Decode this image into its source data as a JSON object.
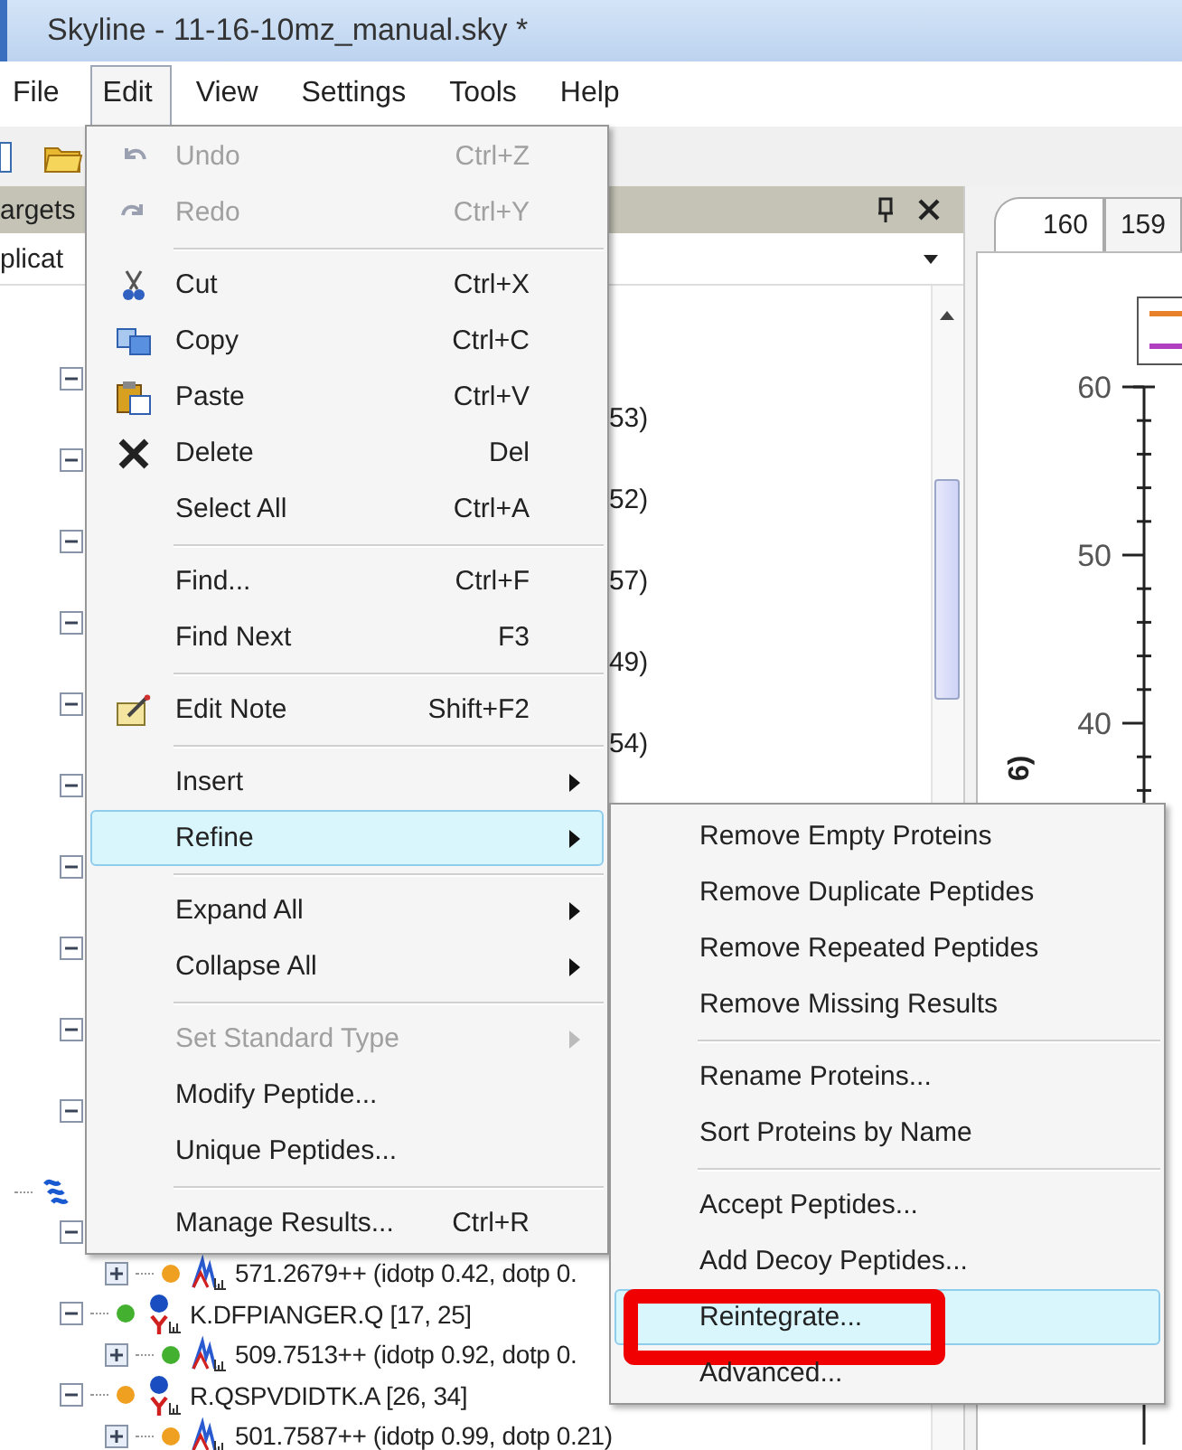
{
  "window": {
    "title": "Skyline - 11-16-10mz_manual.sky *"
  },
  "menubar": [
    {
      "label": "File",
      "selected": false
    },
    {
      "label": "Edit",
      "selected": true
    },
    {
      "label": "View",
      "selected": false
    },
    {
      "label": "Settings",
      "selected": false
    },
    {
      "label": "Tools",
      "selected": false
    },
    {
      "label": "Help",
      "selected": false
    }
  ],
  "targets_panel": {
    "title": "argets",
    "replicate": "plicat",
    "rows": [
      {
        "kind": "peptide",
        "expanded": true
      },
      {
        "kind": "precursor",
        "tail": "53)"
      },
      {
        "kind": "peptide",
        "expanded": true
      },
      {
        "kind": "precursor",
        "tail": "52)"
      },
      {
        "kind": "peptide",
        "expanded": true
      },
      {
        "kind": "precursor",
        "tail": "57)"
      },
      {
        "kind": "peptide",
        "expanded": true
      },
      {
        "kind": "precursor",
        "tail": "49)"
      },
      {
        "kind": "peptide",
        "expanded": true
      },
      {
        "kind": "precursor",
        "tail": "54)"
      },
      {
        "kind": "peptide",
        "expanded": true
      },
      {
        "kind": "precursor"
      },
      {
        "kind": "peptide",
        "expanded": true
      },
      {
        "kind": "precursor"
      },
      {
        "kind": "peptide",
        "expanded": true
      },
      {
        "kind": "precursor"
      },
      {
        "kind": "peptide",
        "expanded": true
      },
      {
        "kind": "precursor"
      },
      {
        "kind": "peptide",
        "expanded": true
      },
      {
        "kind": "precursor"
      },
      {
        "kind": "protein"
      },
      {
        "kind": "peptide",
        "expanded": true
      },
      {
        "kind": "precursor",
        "expanded": false,
        "color": "#f0a020",
        "text": "571.2679++ (idotp 0.42, dotp 0."
      },
      {
        "kind": "peptide",
        "expanded": true,
        "color": "#44b030",
        "text": "K.DFPIANGER.Q [17, 25]"
      },
      {
        "kind": "precursor",
        "expanded": false,
        "color": "#44b030",
        "text": "509.7513++ (idotp 0.92, dotp 0."
      },
      {
        "kind": "peptide",
        "expanded": true,
        "color": "#f0a020",
        "text": "R.QSPVDIDTK.A [26, 34]"
      },
      {
        "kind": "precursor",
        "expanded": false,
        "color": "#f0a020",
        "text": "501.7587++ (idotp 0.99, dotp 0.21)"
      }
    ]
  },
  "graph_panel": {
    "tabs": [
      {
        "label": "160",
        "selected": true
      },
      {
        "label": "159",
        "selected": false
      }
    ],
    "legend": [
      {
        "color": "#e8822a"
      },
      {
        "color": "#b040c0"
      }
    ],
    "y_ticks": [
      "60",
      "50",
      "40"
    ],
    "axis_label": "6)"
  },
  "edit_menu": [
    {
      "kind": "item",
      "label": "Undo",
      "shortcut": "Ctrl+Z",
      "disabled": true,
      "selected": false,
      "submenu": false
    },
    {
      "kind": "item",
      "label": "Redo",
      "shortcut": "Ctrl+Y",
      "disabled": true,
      "selected": false,
      "submenu": false
    },
    {
      "kind": "separator"
    },
    {
      "kind": "item",
      "label": "Cut",
      "shortcut": "Ctrl+X",
      "disabled": false,
      "selected": false,
      "submenu": false
    },
    {
      "kind": "item",
      "label": "Copy",
      "shortcut": "Ctrl+C",
      "disabled": false,
      "selected": false,
      "submenu": false
    },
    {
      "kind": "item",
      "label": "Paste",
      "shortcut": "Ctrl+V",
      "disabled": false,
      "selected": false,
      "submenu": false
    },
    {
      "kind": "item",
      "label": "Delete",
      "shortcut": "Del",
      "disabled": false,
      "selected": false,
      "submenu": false
    },
    {
      "kind": "item",
      "label": "Select All",
      "shortcut": "Ctrl+A",
      "disabled": false,
      "selected": false,
      "submenu": false
    },
    {
      "kind": "separator"
    },
    {
      "kind": "item",
      "label": "Find...",
      "shortcut": "Ctrl+F",
      "disabled": false,
      "selected": false,
      "submenu": false
    },
    {
      "kind": "item",
      "label": "Find Next",
      "shortcut": "F3",
      "disabled": false,
      "selected": false,
      "submenu": false
    },
    {
      "kind": "separator"
    },
    {
      "kind": "item",
      "label": "Edit Note",
      "shortcut": "Shift+F2",
      "disabled": false,
      "selected": false,
      "submenu": false
    },
    {
      "kind": "separator"
    },
    {
      "kind": "item",
      "label": "Insert",
      "disabled": false,
      "selected": false,
      "submenu": true
    },
    {
      "kind": "item",
      "label": "Refine",
      "disabled": false,
      "selected": true,
      "submenu": true
    },
    {
      "kind": "separator"
    },
    {
      "kind": "item",
      "label": "Expand All",
      "disabled": false,
      "selected": false,
      "submenu": true
    },
    {
      "kind": "item",
      "label": "Collapse All",
      "disabled": false,
      "selected": false,
      "submenu": true
    },
    {
      "kind": "separator"
    },
    {
      "kind": "item",
      "label": "Set Standard Type",
      "disabled": true,
      "selected": false,
      "submenu": true
    },
    {
      "kind": "item",
      "label": "Modify Peptide...",
      "disabled": false,
      "selected": false,
      "submenu": false
    },
    {
      "kind": "item",
      "label": "Unique Peptides...",
      "disabled": false,
      "selected": false,
      "submenu": false
    },
    {
      "kind": "separator"
    },
    {
      "kind": "item",
      "label": "Manage Results...",
      "shortcut": "Ctrl+R",
      "disabled": false,
      "selected": false,
      "submenu": false
    }
  ],
  "refine_menu": [
    {
      "kind": "item",
      "label": "Remove Empty Proteins",
      "selected": false,
      "annotated": false
    },
    {
      "kind": "item",
      "label": "Remove Duplicate Peptides",
      "selected": false,
      "annotated": false
    },
    {
      "kind": "item",
      "label": "Remove Repeated Peptides",
      "selected": false,
      "annotated": false
    },
    {
      "kind": "item",
      "label": "Remove Missing Results",
      "selected": false,
      "annotated": false
    },
    {
      "kind": "separator"
    },
    {
      "kind": "item",
      "label": "Rename Proteins...",
      "selected": false,
      "annotated": false
    },
    {
      "kind": "item",
      "label": "Sort Proteins by Name",
      "selected": false,
      "annotated": false
    },
    {
      "kind": "separator"
    },
    {
      "kind": "item",
      "label": "Accept Peptides...",
      "selected": false,
      "annotated": false
    },
    {
      "kind": "item",
      "label": "Add Decoy Peptides...",
      "selected": false,
      "annotated": false
    },
    {
      "kind": "item",
      "label": "Reintegrate...",
      "selected": true,
      "annotated": true
    },
    {
      "kind": "item",
      "label": "Advanced...",
      "selected": false,
      "annotated": false
    }
  ]
}
